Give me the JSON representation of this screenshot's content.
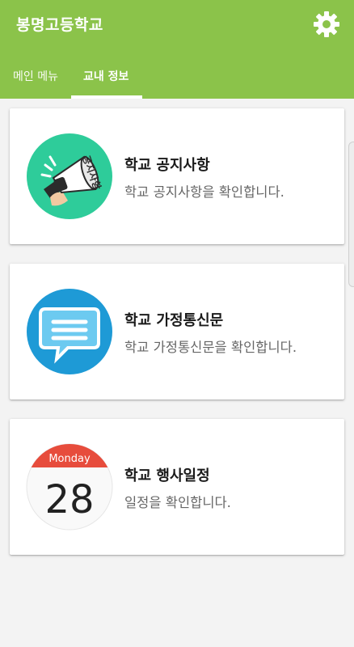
{
  "app": {
    "title": "봉명고등학교"
  },
  "tabs": [
    {
      "label": "메인 메뉴"
    },
    {
      "label": "교내 정보"
    }
  ],
  "cards": [
    {
      "title": "학교 공지사항",
      "subtitle": "학교 공지사항을 확인합니다.",
      "icon": "megaphone-icon",
      "icon_text": "공지사항"
    },
    {
      "title": "학교 가정통신문",
      "subtitle": "학교 가정통신문을 확인합니다.",
      "icon": "message-icon"
    },
    {
      "title": "학교 행사일정",
      "subtitle": "일정을 확인합니다.",
      "icon": "calendar-icon",
      "calendar_day_name": "Monday",
      "calendar_day_number": "28"
    }
  ],
  "colors": {
    "appbar": "#8bc34a",
    "megaphone_bg": "#2ecc9a",
    "message_bg": "#1e9ad6",
    "calendar_header": "#e74c3c"
  }
}
